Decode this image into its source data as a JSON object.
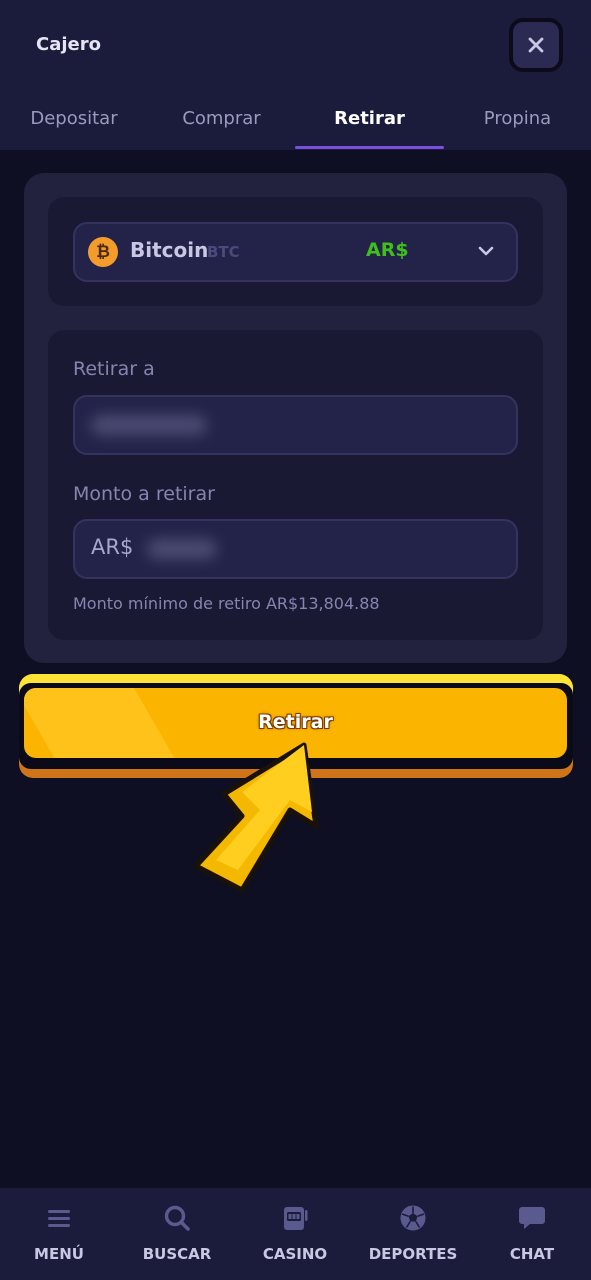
{
  "header": {
    "title": "Cajero",
    "close_icon": "close-icon"
  },
  "tabs": [
    {
      "label": "Depositar",
      "active": false
    },
    {
      "label": "Comprar",
      "active": false
    },
    {
      "label": "Retirar",
      "active": true
    },
    {
      "label": "Propina",
      "active": false
    }
  ],
  "currency": {
    "coin_icon": "bitcoin-icon",
    "coin_symbol_glyph": "₿",
    "coin_name": "Bitcoin",
    "coin_code": "BTC",
    "fiat": "AR$",
    "fiat_color": "#3fbf1c"
  },
  "form": {
    "address_label": "Retirar a",
    "amount_label": "Monto a retirar",
    "amount_prefix": "AR$",
    "min_note": "Monto mínimo de retiro AR$13,804.88"
  },
  "action": {
    "label": "Retirar",
    "color": "#fbb400"
  },
  "nav": [
    {
      "label": "MENÚ",
      "icon": "menu-icon"
    },
    {
      "label": "BUSCAR",
      "icon": "search-icon"
    },
    {
      "label": "CASINO",
      "icon": "slot-machine-icon"
    },
    {
      "label": "DEPORTES",
      "icon": "soccer-ball-icon"
    },
    {
      "label": "CHAT",
      "icon": "chat-icon"
    }
  ],
  "colors": {
    "background": "#0e0f22",
    "panel": "#1b1b3b",
    "accent": "#7a4fe0"
  }
}
